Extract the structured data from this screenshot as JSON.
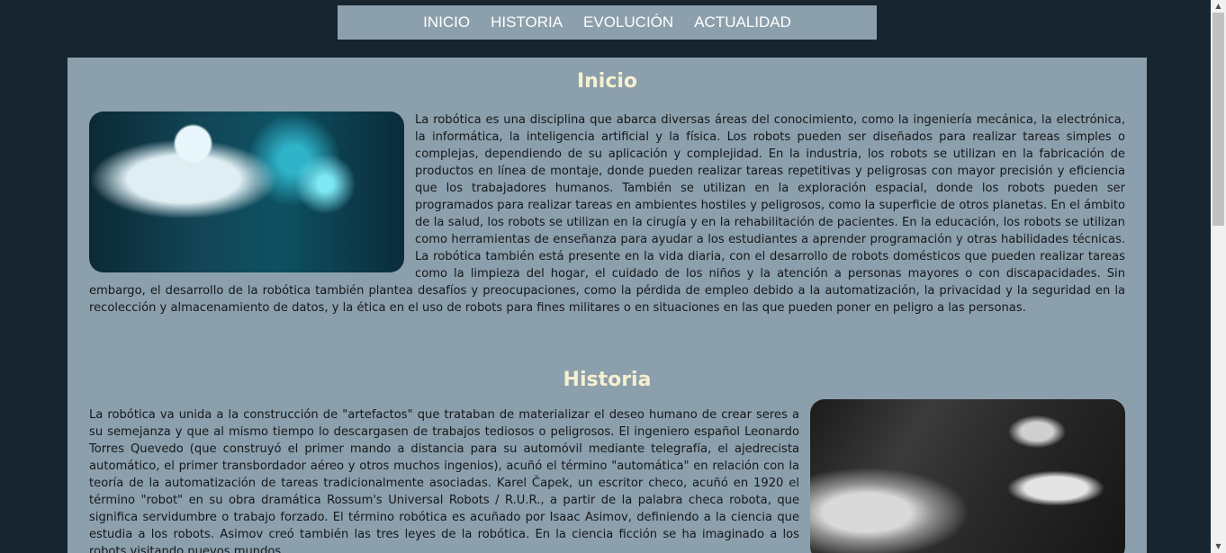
{
  "nav": {
    "items": [
      "INICIO",
      "HISTORIA",
      "EVOLUCIÓN",
      "ACTUALIDAD"
    ]
  },
  "inicio": {
    "title": "Inicio",
    "text": "La robótica es una disciplina que abarca diversas áreas del conocimiento, como la ingeniería mecánica, la electrónica, la informática, la inteligencia artificial y la física. Los robots pueden ser diseñados para realizar tareas simples o complejas, dependiendo de su aplicación y complejidad. En la industria, los robots se utilizan en la fabricación de productos en línea de montaje, donde pueden realizar tareas repetitivas y peligrosas con mayor precisión y eficiencia que los trabajadores humanos. También se utilizan en la exploración espacial, donde los robots pueden ser programados para realizar tareas en ambientes hostiles y peligrosos, como la superficie de otros planetas. En el ámbito de la salud, los robots se utilizan en la cirugía y en la rehabilitación de pacientes. En la educación, los robots se utilizan como herramientas de enseñanza para ayudar a los estudiantes a aprender programación y otras habilidades técnicas. La robótica también está presente en la vida diaria, con el desarrollo de robots domésticos que pueden realizar tareas como la limpieza del hogar, el cuidado de los niños y la atención a personas mayores o con discapacidades. Sin embargo, el desarrollo de la robótica también plantea desafíos y preocupaciones, como la pérdida de empleo debido a la automatización, la privacidad y la seguridad en la recolección y almacenamiento de datos, y la ética en el uso de robots para fines militares o en situaciones en las que pueden poner en peligro a las personas."
  },
  "historia": {
    "title": "Historia",
    "text": "La robótica va unida a la construcción de \"artefactos\" que trataban de materializar el deseo humano de crear seres a su semejanza y que al mismo tiempo lo descargasen de trabajos tediosos o peligrosos. El ingeniero español Leonardo Torres Quevedo (que construyó el primer mando a distancia para su automóvil mediante telegrafía, el ajedrecista automático, el primer transbordador aéreo y otros muchos ingenios), acuñó el término \"automática\" en relación con la teoría de la automatización de tareas tradicionalmente asociadas. Karel Čapek, un escritor checo, acuñó en 1920 el término \"robot\" en su obra dramática Rossum's Universal Robots / R.U.R., a partir de la palabra checa robota, que significa servidumbre o trabajo forzado. El término robótica es acuñado por Isaac Asimov, definiendo a la ciencia que estudia a los robots. Asimov creó también las tres leyes de la robótica. En la ciencia ficción se ha imaginado a los robots visitando nuevos mundos,"
  }
}
